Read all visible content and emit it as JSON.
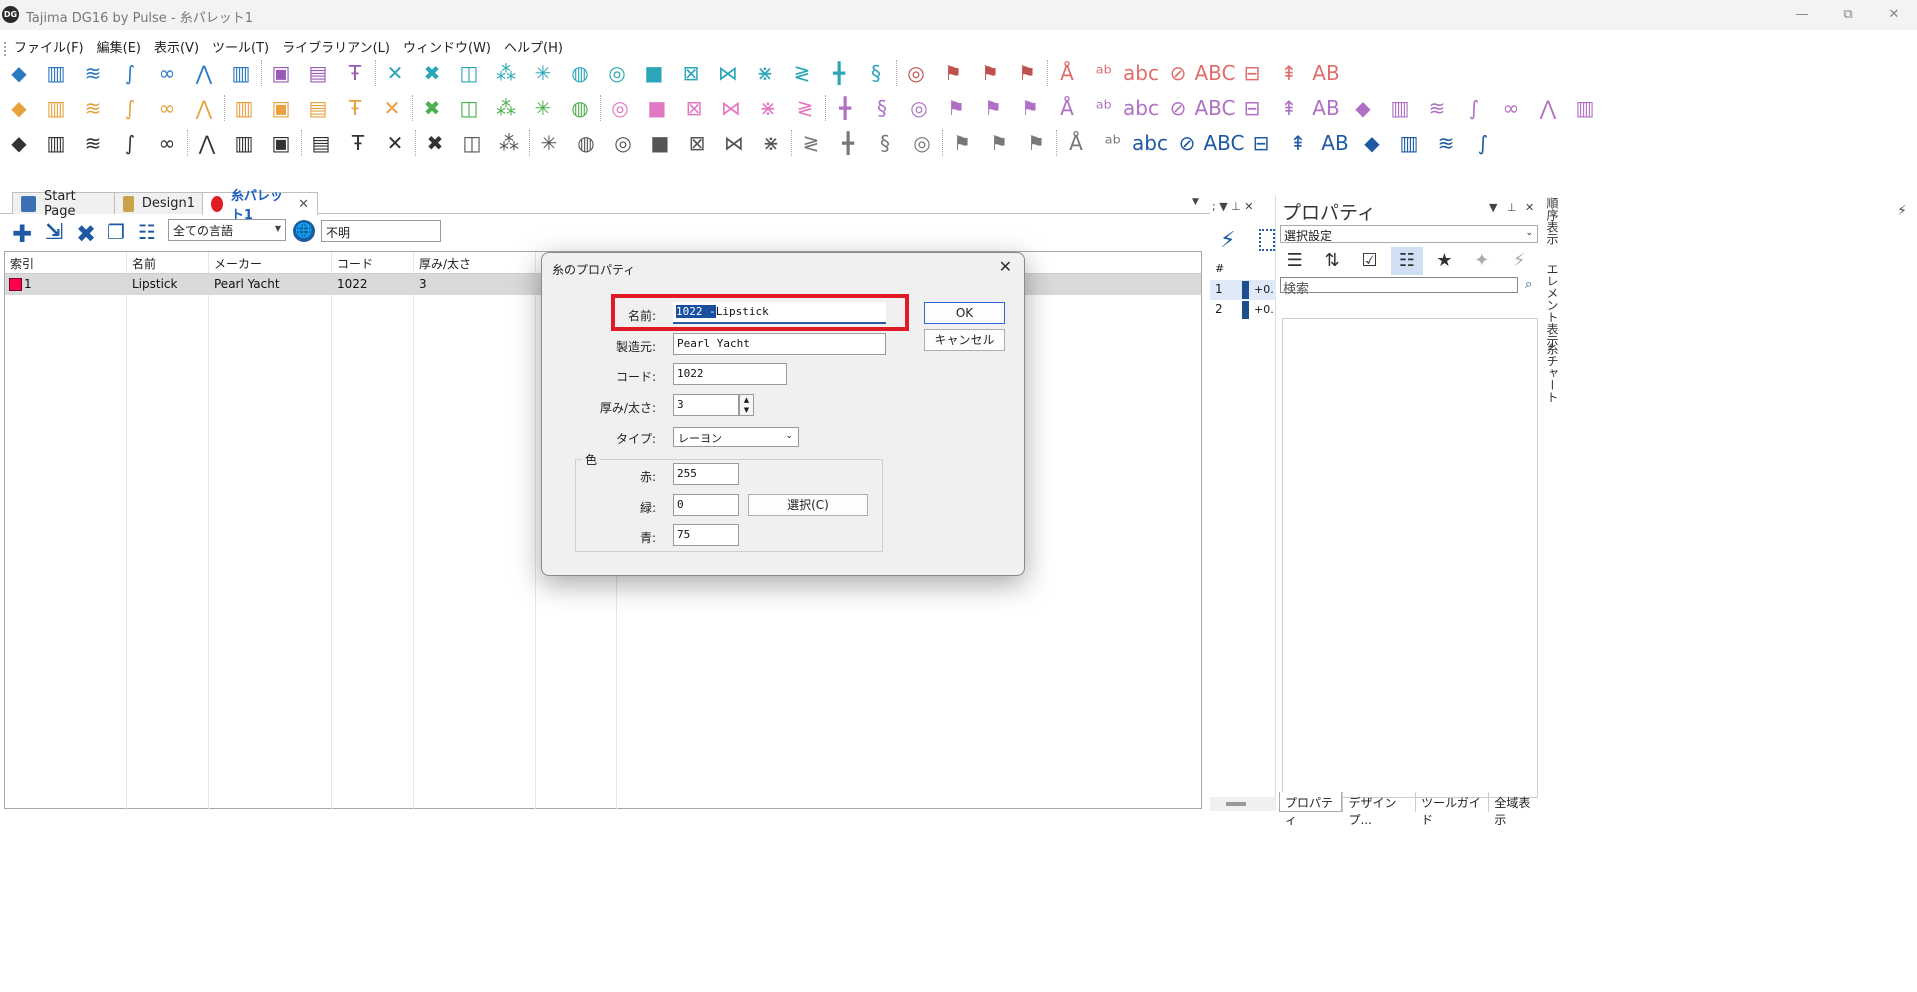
{
  "window": {
    "title": "Tajima DG16 by Pulse - 糸パレット1",
    "logo_text": "DG",
    "controls": [
      "—",
      "⧉",
      "✕"
    ]
  },
  "menu": [
    "ファイル(F)",
    "編集(E)",
    "表示(V)",
    "ツール(T)",
    "ライブラリアン(L)",
    "ウィンドウ(W)",
    "ヘルプ(H)"
  ],
  "toolbar_icons": {
    "row1": [
      "fill-icon",
      "column-icon",
      "zigzag-icon",
      "running-icon",
      "motif-icon",
      "satin-icon",
      "column-dd-icon",
      "image-icon",
      "image-frame-icon",
      "text-tool-icon",
      "cross-icon",
      "crosshatch-icon",
      "spiral-square-icon",
      "dots-icon",
      "star-icon",
      "circle-fill-icon",
      "spiral-icon",
      "square-fill-icon",
      "square-cross-icon",
      "net-icon",
      "net2-icon",
      "zigzag-s-icon",
      "column-point-icon",
      "s-curve-icon",
      "target-icon",
      "flag-icon",
      "flag2-icon",
      "flag3-icon",
      "letter-a-icon",
      "abc-icon",
      "abc2-icon",
      "monogram-icon",
      "abc3-icon",
      "abc-box-icon",
      "tree-icon",
      "ab-icon"
    ],
    "row2": [
      "combine-icon",
      "combine2-icon",
      "point-icon",
      "transform-icon",
      "rotate-icon",
      "mirror-icon",
      "group-icon",
      "triangle-icon",
      "arch-icon",
      "circles-icon",
      "tri2-icon",
      "node-icon",
      "node2-icon",
      "join-icon",
      "join2-icon",
      "join3-icon",
      "sel-icon",
      "align-icon",
      "weld-icon",
      "warp-icon",
      "warp2-icon",
      "warp3-icon",
      "arrow-select-icon",
      "lasso-icon",
      "knife-icon",
      "edit1-icon",
      "edit2-icon",
      "edit3-icon",
      "edit4-icon",
      "edit5-icon",
      "edit6-icon",
      "edit7-icon",
      "edit8-icon",
      "edit9-icon",
      "edit10-icon",
      "edit11-icon",
      "edit12-icon",
      "edit13-icon",
      "edit14-icon",
      "edit15-icon",
      "edit16-icon",
      "edit17-icon",
      "edit18-icon"
    ],
    "row3": [
      "new-icon",
      "open-icon",
      "open2-icon",
      "save-icon",
      "save-as-icon",
      "cut-icon",
      "copy-icon",
      "paste-icon",
      "print-icon",
      "print-preview-icon",
      "settings-icon",
      "ruler-icon",
      "brush-icon",
      "brush2-icon",
      "zoom-icon",
      "zoom-in-icon",
      "zoom-out-icon",
      "zoom-fit-icon",
      "zoom-1-1-icon",
      "zoom-all-icon",
      "screen-icon",
      "pencil-icon",
      "rectangle-icon",
      "ellipse-icon",
      "edit-icon",
      "undo-icon",
      "redo-icon",
      "refresh-icon",
      "scissors-icon",
      "stitch-icon",
      "traffic-light-icon",
      "arc-icon",
      "heart-icon",
      "ring-icon",
      "sparkle-icon",
      "face-icon",
      "machine-icon",
      "machine2-icon",
      "machine3-icon",
      "machine4-icon"
    ]
  },
  "tabs": [
    {
      "label": "Start Page"
    },
    {
      "label": "Design1"
    },
    {
      "label": "糸パレット1",
      "close": "✕"
    }
  ],
  "palette_toolbar": {
    "language": "全ての言語",
    "filter": "不明",
    "globe": "🌐"
  },
  "grid": {
    "headers": [
      "索引",
      "名前",
      "メーカー",
      "コード",
      "厚み/太さ"
    ],
    "rows": [
      {
        "index": "1",
        "name": "Lipstick",
        "maker": "Pearl Yacht",
        "code": "1022",
        "weight": "3",
        "color": "#ff004b"
      }
    ]
  },
  "side_small": {
    "hash": "#",
    "rows": [
      {
        "n": "1",
        "v": "+0."
      },
      {
        "n": "2",
        "v": "+0."
      }
    ]
  },
  "properties": {
    "title": "プロパティ",
    "selection": "選択設定",
    "search_placeholder": "検索",
    "bottom_tabs": [
      "プロパティ",
      "デザインプ...",
      "ツールガイド",
      "全域表示"
    ],
    "vertical_tabs": [
      "順序表示",
      "エレメント表示",
      "糸チャート"
    ]
  },
  "dialog": {
    "title": "糸のプロパティ",
    "name_label": "名前:",
    "name_selected": "1022 -",
    "name_rest": "Lipstick",
    "maker_label": "製造元:",
    "maker_value": "Pearl Yacht",
    "code_label": "コード:",
    "code_value": "1022",
    "weight_label": "厚み/太さ:",
    "weight_value": "3",
    "type_label": "タイプ:",
    "type_value": "レーヨン",
    "color_group": "色",
    "red_label": "赤:",
    "red_value": "255",
    "green_label": "緑:",
    "green_value": "0",
    "blue_label": "青:",
    "blue_value": "75",
    "choose_button": "選択(C)",
    "ok_button": "OK",
    "cancel_button": "キャンセル"
  }
}
